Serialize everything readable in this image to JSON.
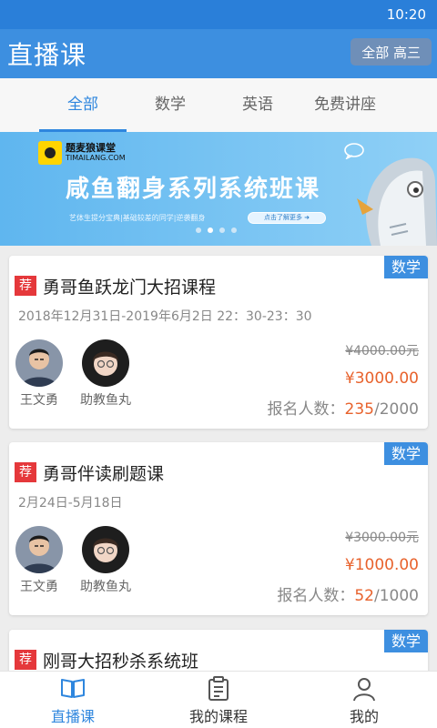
{
  "status_bar": {
    "time": "10:20"
  },
  "header": {
    "title": "直播课",
    "filter_label": "全部 高三"
  },
  "tabs": [
    {
      "label": "全部",
      "active": true
    },
    {
      "label": "数学",
      "active": false
    },
    {
      "label": "英语",
      "active": false
    },
    {
      "label": "免费讲座",
      "active": false
    }
  ],
  "banner": {
    "brand_name": "题麦狼课堂",
    "brand_url": "TIMAILANG.COM",
    "title": "咸鱼翻身系列系统班课",
    "subtitle": "艺体生提分宝典|基础较差的同学|逆袭翻身",
    "button_label": "点击了解更多 ➜",
    "slides": 4,
    "active_slide": 2
  },
  "courses": [
    {
      "subject": "数学",
      "badge": "荐",
      "title": "勇哥鱼跃龙门大招课程",
      "date": "2018年12月31日-2019年6月2日 22：30-23：30",
      "teacher": "王文勇",
      "assistant": "助教鱼丸",
      "original_price": "¥4000.00元",
      "price": "¥3000.00",
      "enroll_label": "报名人数：",
      "enrolled": "235",
      "capacity": "/2000"
    },
    {
      "subject": "数学",
      "badge": "荐",
      "title": "勇哥伴读刷题课",
      "date": "2月24日-5月18日",
      "teacher": "王文勇",
      "assistant": "助教鱼丸",
      "original_price": "¥3000.00元",
      "price": "¥1000.00",
      "enroll_label": "报名人数：",
      "enrolled": "52",
      "capacity": "/1000"
    },
    {
      "subject": "数学",
      "badge": "荐",
      "title": "刚哥大招秒杀系统班"
    }
  ],
  "bottom_nav": [
    {
      "label": "直播课",
      "icon": "book-open-icon",
      "active": true
    },
    {
      "label": "我的课程",
      "icon": "clipboard-icon",
      "active": false
    },
    {
      "label": "我的",
      "icon": "user-icon",
      "active": false
    }
  ],
  "colors": {
    "primary": "#3d8fe0",
    "accent_price": "#e8622c",
    "badge_red": "#e5383b"
  }
}
